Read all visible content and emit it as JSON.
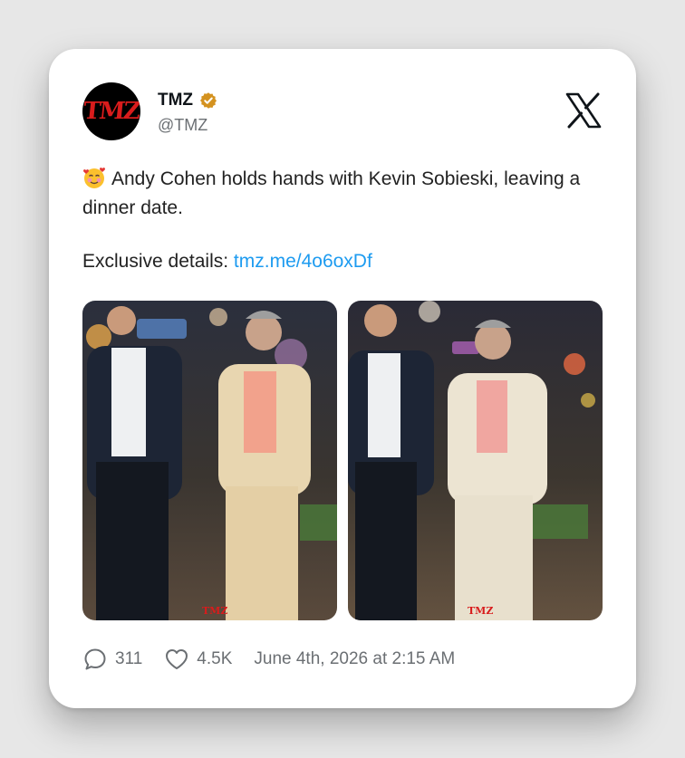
{
  "author": {
    "display_name": "TMZ",
    "handle": "@TMZ",
    "avatar_text": "TMZ"
  },
  "tweet": {
    "emoji": "smiling-face-with-hearts",
    "text": "Andy Cohen holds hands with Kevin Sobieski, leaving a dinner date.",
    "details_prefix": "Exclusive details:",
    "details_link": "tmz.me/4o6oxDf"
  },
  "media": {
    "photos": [
      {
        "description": "two men holding hands walking at night",
        "watermark": "TMZ"
      },
      {
        "description": "two men holding hands walking at night",
        "watermark": "TMZ"
      }
    ]
  },
  "footer": {
    "replies": "311",
    "likes": "4.5K",
    "timestamp": "June 4th, 2026 at 2:15 AM"
  },
  "colors": {
    "link": "#1d9bf0",
    "verified_badge": "#d4921f",
    "brand_red": "#d81c1c"
  }
}
